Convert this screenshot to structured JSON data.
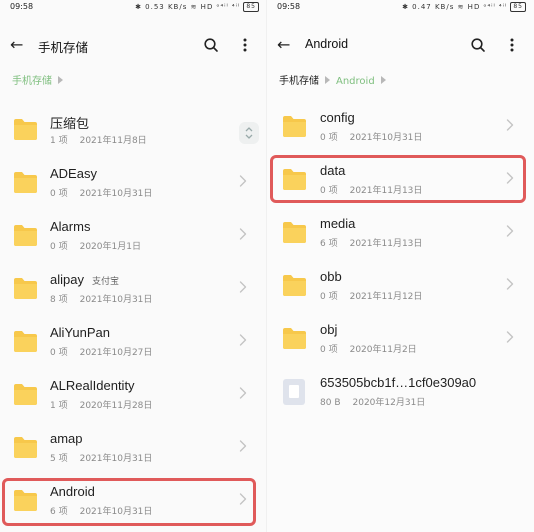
{
  "colors": {
    "folder": "#F7C84B",
    "highlight": "#E05A5A",
    "breadcrumb_green": "#7FBF7F"
  },
  "left": {
    "status": {
      "time": "09:58",
      "icons": "✱ 0.53 KB/s ≋ HD ᵒ⁴ⁱˡ ⁴ⁱˡ",
      "battery": "85"
    },
    "header": {
      "title": "手机存储"
    },
    "breadcrumbs": [
      "手机存储"
    ],
    "items": [
      {
        "name": "压缩包",
        "count": "",
        "date": "2021年11月8日",
        "tag": ""
      },
      {
        "name": "ADEasy",
        "count": "0 项",
        "date": "2021年10月31日",
        "tag": ""
      },
      {
        "name": "Alarms",
        "count": "0 项",
        "date": "2020年1月1日",
        "tag": ""
      },
      {
        "name": "alipay",
        "count": "8 项",
        "date": "2021年10月31日",
        "tag": "支付宝"
      },
      {
        "name": "AliYunPan",
        "count": "0 项",
        "date": "2021年10月27日",
        "tag": ""
      },
      {
        "name": "ALRealIdentity",
        "count": "1 项",
        "date": "2020年11月28日",
        "tag": ""
      },
      {
        "name": "amap",
        "count": "5 项",
        "date": "2021年10月31日",
        "tag": ""
      },
      {
        "name": "Android",
        "count": "6 项",
        "date": "2021年10月31日",
        "tag": ""
      }
    ],
    "first_item_count": "1 项"
  },
  "right": {
    "status": {
      "time": "09:58",
      "icons": "✱ 0.47 KB/s ≋ HD ᵒ⁴ⁱˡ ⁴ⁱˡ",
      "battery": "85"
    },
    "header": {
      "title": "Android"
    },
    "breadcrumbs": [
      "手机存储",
      "Android"
    ],
    "items": [
      {
        "name": "config",
        "count": "0 项",
        "date": "2021年10月31日",
        "type": "folder"
      },
      {
        "name": "data",
        "count": "0 项",
        "date": "2021年11月13日",
        "type": "folder"
      },
      {
        "name": "media",
        "count": "6 项",
        "date": "2021年11月13日",
        "type": "folder"
      },
      {
        "name": "obb",
        "count": "0 项",
        "date": "2021年11月12日",
        "type": "folder"
      },
      {
        "name": "obj",
        "count": "0 项",
        "date": "2020年11月2日",
        "type": "folder"
      },
      {
        "name": "653505bcb1f…1cf0e309a0",
        "count": "80 B",
        "date": "2020年12月31日",
        "type": "file"
      }
    ]
  }
}
